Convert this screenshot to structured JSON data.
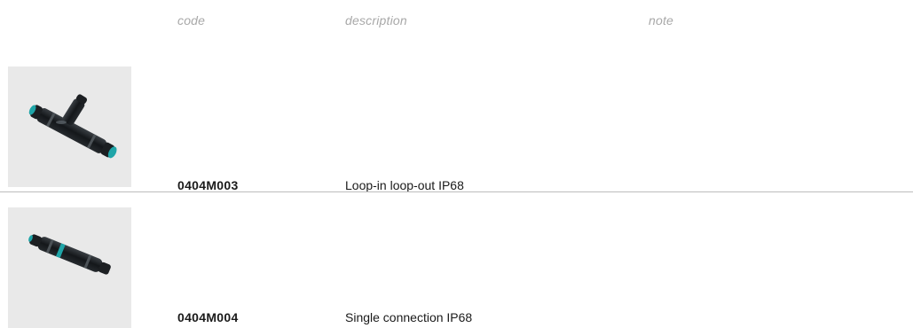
{
  "table": {
    "headers": {
      "code": "code",
      "description": "description",
      "note": "note"
    },
    "rows": [
      {
        "image_icon": "tee-connector-product-photo",
        "code": "0404M003",
        "description": "Loop-in loop-out IP68",
        "note": ""
      },
      {
        "image_icon": "inline-connector-product-photo",
        "code": "0404M004",
        "description": "Single connection IP68",
        "note": ""
      }
    ]
  },
  "colors": {
    "header_text": "#a8a8a8",
    "body_text": "#1a1a1a",
    "thumb_bg": "#e9e9e9",
    "divider": "#bdbdbd",
    "connector_body": "#1c1f22",
    "connector_accent": "#1fa5a8"
  }
}
